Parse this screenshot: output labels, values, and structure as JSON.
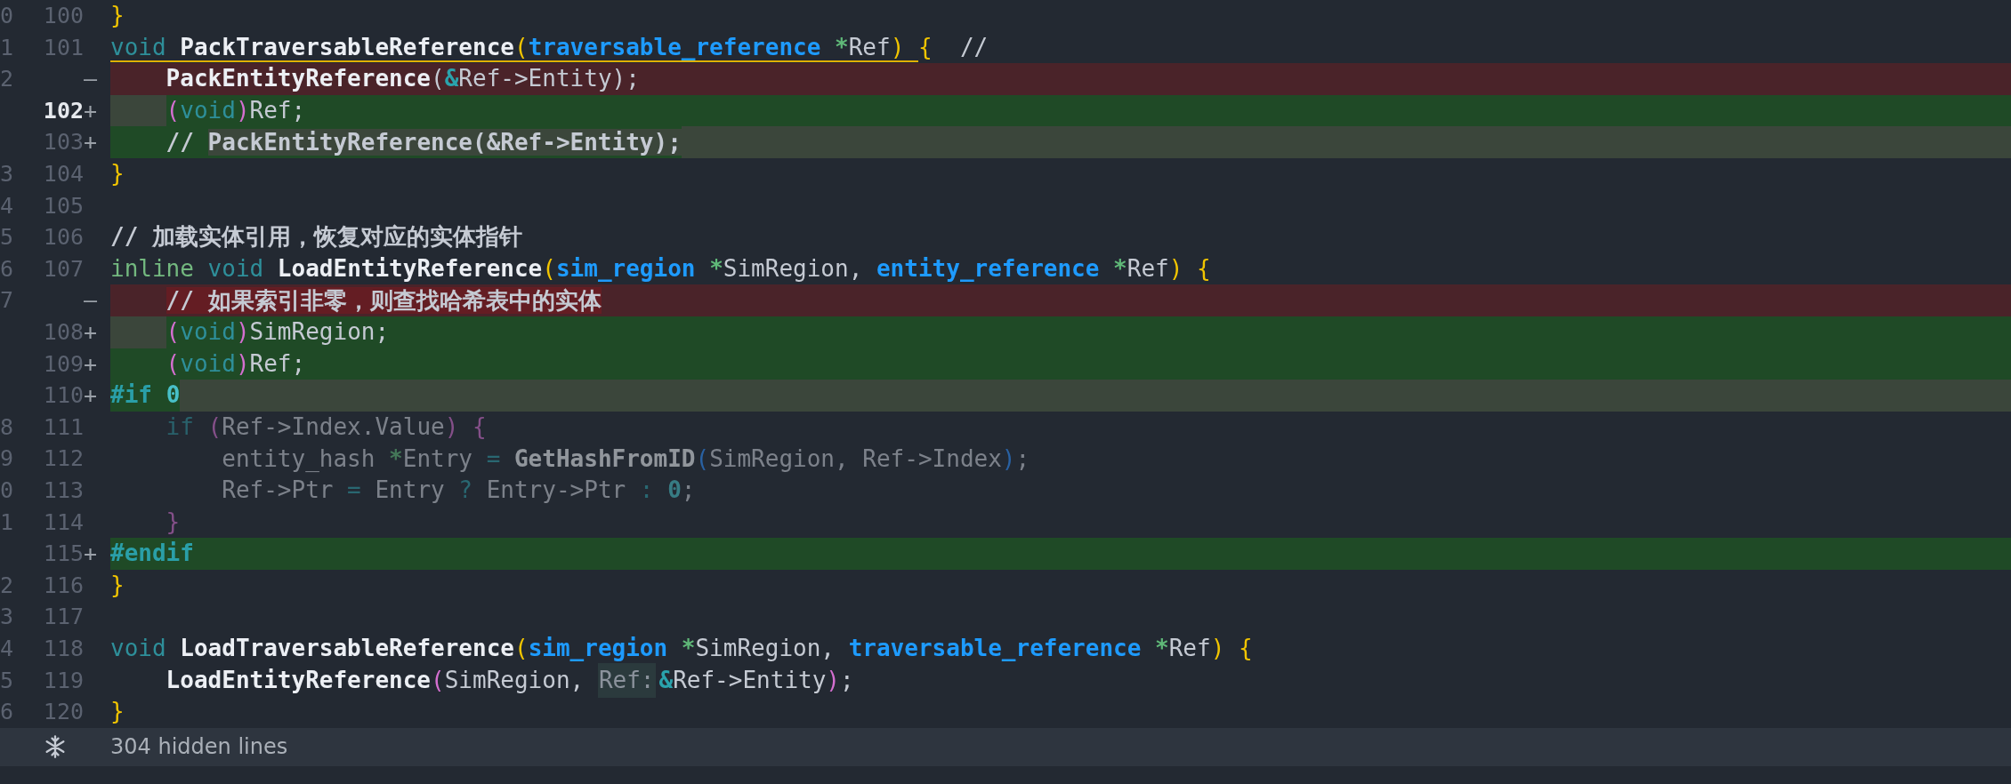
{
  "rows": [
    {
      "old": "0",
      "new": "100",
      "kind": "context",
      "current": false,
      "tokens": [
        {
          "kind": "py",
          "text": "}"
        }
      ]
    },
    {
      "old": "1",
      "new": "101",
      "kind": "context",
      "current": false,
      "tokens": [
        {
          "kind": "kw",
          "text": "void ",
          "underlined": true
        },
        {
          "kind": "fn",
          "text": "PackTraversableReference",
          "underlined": true
        },
        {
          "kind": "py",
          "text": "(",
          "underlined": true
        },
        {
          "kind": "type",
          "text": "traversable_reference ",
          "underlined": true
        },
        {
          "kind": "ptr",
          "text": "*",
          "underlined": true
        },
        {
          "kind": "id",
          "text": "Ref",
          "underlined": true
        },
        {
          "kind": "py",
          "text": ") ",
          "underlined": true
        },
        {
          "kind": "py",
          "text": "{  "
        },
        {
          "kind": "id",
          "text": "//"
        }
      ]
    },
    {
      "old": "2",
      "marker": "—",
      "kind": "deleted",
      "tokens": [
        {
          "kind": "fn",
          "text": "    PackEntityReference"
        },
        {
          "kind": "id",
          "text": "("
        },
        {
          "kind": "amp",
          "text": "&"
        },
        {
          "kind": "id",
          "text": "Ref->Entity);"
        }
      ]
    },
    {
      "new": "102",
      "marker": "+",
      "kind": "added",
      "current": true,
      "indent_changed": true,
      "tokens": [
        {
          "kind": "pp",
          "text": "    ("
        },
        {
          "kind": "kw",
          "text": "void"
        },
        {
          "kind": "pp",
          "text": ")"
        },
        {
          "kind": "id",
          "text": "Ref;"
        }
      ]
    },
    {
      "new": "103",
      "marker": "+",
      "kind": "added",
      "current": false,
      "changed_to_end": true,
      "tokens": [
        {
          "kind": "comment",
          "text": "    // "
        },
        {
          "kind": "comment",
          "text": "PackEntityReference(&Ref->Entity);",
          "changed": true
        }
      ]
    },
    {
      "old": "3",
      "new": "104",
      "kind": "context",
      "current": false,
      "tokens": [
        {
          "kind": "py",
          "text": "}"
        }
      ]
    },
    {
      "old": "4",
      "new": "105",
      "kind": "context",
      "current": false,
      "tokens": []
    },
    {
      "old": "5",
      "new": "106",
      "kind": "context",
      "current": false,
      "tokens": [
        {
          "kind": "comment",
          "text": "// 加载实体引用，恢复对应的实体指针"
        }
      ]
    },
    {
      "old": "6",
      "new": "107",
      "kind": "context",
      "current": false,
      "tokens": [
        {
          "kind": "kw2",
          "text": "inline "
        },
        {
          "kind": "kw",
          "text": "void "
        },
        {
          "kind": "fn",
          "text": "LoadEntityReference"
        },
        {
          "kind": "py",
          "text": "("
        },
        {
          "kind": "type",
          "text": "sim_region "
        },
        {
          "kind": "ptr",
          "text": "*"
        },
        {
          "kind": "id",
          "text": "SimRegion, "
        },
        {
          "kind": "type",
          "text": "entity_reference "
        },
        {
          "kind": "ptr",
          "text": "*"
        },
        {
          "kind": "id",
          "text": "Ref"
        },
        {
          "kind": "py",
          "text": ") {"
        }
      ]
    },
    {
      "old": "7",
      "marker": "—",
      "kind": "deleted",
      "indent_plain": true,
      "tokens": [
        {
          "kind": "comment",
          "text": "// 如果索引非零，则查找哈希表中的实体",
          "changed": true
        }
      ]
    },
    {
      "new": "108",
      "marker": "+",
      "kind": "added",
      "current": false,
      "indent_changed": true,
      "tokens": [
        {
          "kind": "pp",
          "text": "    ("
        },
        {
          "kind": "kw",
          "text": "void"
        },
        {
          "kind": "pp",
          "text": ")"
        },
        {
          "kind": "id",
          "text": "SimRegion;"
        }
      ]
    },
    {
      "new": "109",
      "marker": "+",
      "kind": "added",
      "current": false,
      "tokens": [
        {
          "kind": "pp",
          "text": "    ("
        },
        {
          "kind": "kw",
          "text": "void"
        },
        {
          "kind": "pp",
          "text": ")"
        },
        {
          "kind": "id",
          "text": "Ref;"
        }
      ]
    },
    {
      "new": "110",
      "marker": "+",
      "kind": "added",
      "current": false,
      "changed_to_end": true,
      "tokens": [
        {
          "kind": "pre",
          "text": "#if "
        },
        {
          "kind": "num",
          "text": "0"
        }
      ]
    },
    {
      "old": "8",
      "new": "111",
      "kind": "context",
      "current": false,
      "dimmed": true,
      "tokens": [
        {
          "kind": "kw",
          "text": "    if "
        },
        {
          "kind": "pp",
          "text": "("
        },
        {
          "kind": "id",
          "text": "Ref->Index.Value"
        },
        {
          "kind": "pp",
          "text": ") {"
        }
      ]
    },
    {
      "old": "9",
      "new": "112",
      "kind": "context",
      "current": false,
      "dimmed": true,
      "tokens": [
        {
          "kind": "id",
          "text": "        entity_hash "
        },
        {
          "kind": "ptr",
          "text": "*"
        },
        {
          "kind": "id",
          "text": "Entry "
        },
        {
          "kind": "op",
          "text": "= "
        },
        {
          "kind": "fn",
          "text": "GetHashFromID"
        },
        {
          "kind": "pb",
          "text": "("
        },
        {
          "kind": "id",
          "text": "SimRegion, Ref->Index"
        },
        {
          "kind": "pb",
          "text": ")"
        },
        {
          "kind": "id",
          "text": ";"
        }
      ]
    },
    {
      "old": "0",
      "new": "113",
      "kind": "context",
      "current": false,
      "dimmed": true,
      "tokens": [
        {
          "kind": "id",
          "text": "        Ref->Ptr "
        },
        {
          "kind": "op",
          "text": "= "
        },
        {
          "kind": "id",
          "text": "Entry "
        },
        {
          "kind": "op",
          "text": "? "
        },
        {
          "kind": "id",
          "text": "Entry->Ptr "
        },
        {
          "kind": "op",
          "text": ": "
        },
        {
          "kind": "num",
          "text": "0"
        },
        {
          "kind": "id",
          "text": ";"
        }
      ]
    },
    {
      "old": "1",
      "new": "114",
      "kind": "context",
      "current": false,
      "dimmed": true,
      "tokens": [
        {
          "kind": "pp",
          "text": "    }"
        }
      ]
    },
    {
      "new": "115",
      "marker": "+",
      "kind": "added",
      "current": false,
      "tokens": [
        {
          "kind": "pre",
          "text": "#endif"
        }
      ]
    },
    {
      "old": "2",
      "new": "116",
      "kind": "context",
      "current": false,
      "tokens": [
        {
          "kind": "py",
          "text": "}"
        }
      ]
    },
    {
      "old": "3",
      "new": "117",
      "kind": "context",
      "current": false,
      "tokens": []
    },
    {
      "old": "4",
      "new": "118",
      "kind": "context",
      "current": false,
      "tokens": [
        {
          "kind": "kw",
          "text": "void "
        },
        {
          "kind": "fn",
          "text": "LoadTraversableReference"
        },
        {
          "kind": "py",
          "text": "("
        },
        {
          "kind": "type",
          "text": "sim_region "
        },
        {
          "kind": "ptr",
          "text": "*"
        },
        {
          "kind": "id",
          "text": "SimRegion, "
        },
        {
          "kind": "type",
          "text": "traversable_reference "
        },
        {
          "kind": "ptr",
          "text": "*"
        },
        {
          "kind": "id",
          "text": "Ref"
        },
        {
          "kind": "py",
          "text": ") {"
        }
      ]
    },
    {
      "old": "5",
      "new": "119",
      "kind": "context",
      "current": false,
      "tokens": [
        {
          "kind": "fn",
          "text": "    LoadEntityReference"
        },
        {
          "kind": "pp",
          "text": "("
        },
        {
          "kind": "id",
          "text": "SimRegion, "
        },
        {
          "kind": "hint",
          "text": "Ref:"
        },
        {
          "kind": "amp",
          "text": "&"
        },
        {
          "kind": "id",
          "text": "Ref->Entity"
        },
        {
          "kind": "pp",
          "text": ")"
        },
        {
          "kind": "id",
          "text": ";"
        }
      ]
    },
    {
      "old": "6",
      "new": "120",
      "kind": "context",
      "current": false,
      "tokens": [
        {
          "kind": "py",
          "text": "}"
        }
      ]
    }
  ],
  "footer": {
    "hidden_lines": "304 hidden lines"
  }
}
